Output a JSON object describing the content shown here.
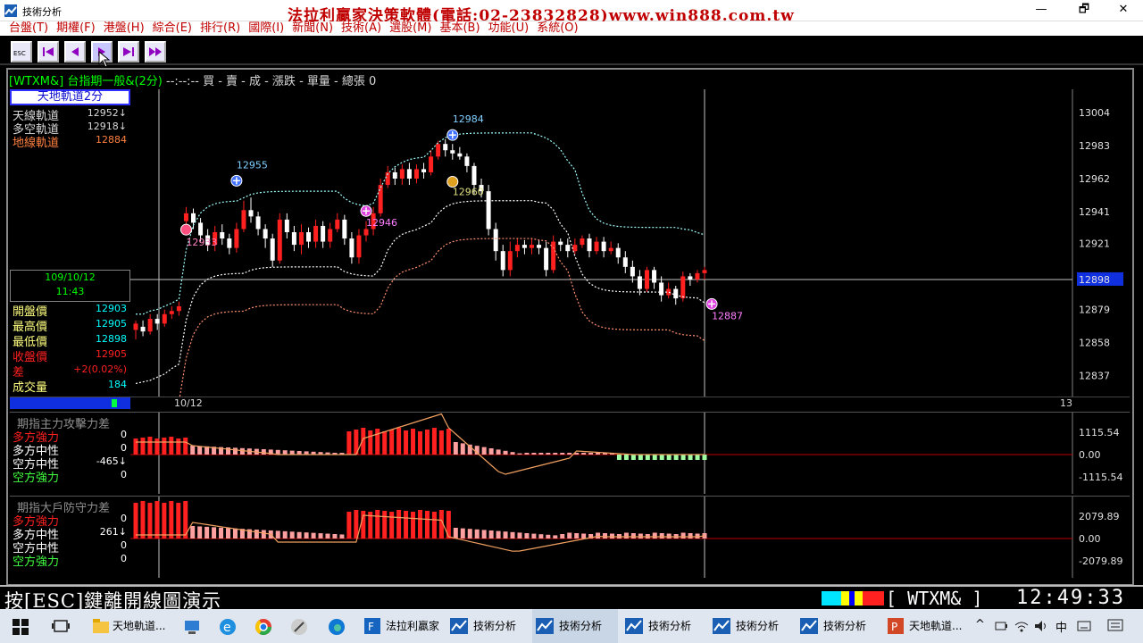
{
  "window": {
    "title": "技術分析",
    "banner": "法拉利贏家決策軟體(電話:02-23832828)www.win888.com.tw",
    "min_label": "—",
    "max_label": "🗗",
    "close_label": "✕"
  },
  "menu": [
    "台盤(T)",
    "期權(F)",
    "港盤(H)",
    "綜合(E)",
    "排行(R)",
    "國際(I)",
    "新聞(N)",
    "技術(A)",
    "選股(M)",
    "基本(B)",
    "功能(U)",
    "系統(O)"
  ],
  "toolbar": {
    "esc_label": "ESC"
  },
  "header": {
    "symbol": "[WTXM&] 台指期一般&(2分)",
    "rest": "--:--:-- 買 - 賣 - 成 - 漲跌 - 單量 - 總張 0"
  },
  "panel": {
    "title": "天地軌道2分",
    "indicators": [
      {
        "label": "天線軌道",
        "value": "12952",
        "arrow": "↓",
        "color": "#d8d8d8"
      },
      {
        "label": "多空軌道",
        "value": "12918",
        "arrow": "↓",
        "color": "#d8d8d8"
      },
      {
        "label": "地線軌道",
        "value": "12884",
        "arrow": "",
        "color": "#ff8040"
      }
    ],
    "date": "109/10/12",
    "time": "11:43",
    "quotes": [
      {
        "label": "開盤價",
        "value": "12903",
        "color": "#ffff80",
        "vcolor": "#00ffff"
      },
      {
        "label": "最高價",
        "value": "12905",
        "color": "#ffff80",
        "vcolor": "#00ffff"
      },
      {
        "label": "最低價",
        "value": "12898",
        "color": "#ffff80",
        "vcolor": "#00ffff"
      },
      {
        "label": "收盤價",
        "value": "12905",
        "color": "#ff2020",
        "vcolor": "#ff2020"
      },
      {
        "label": "差",
        "value": "+2(0.02%)",
        "color": "#ff2020",
        "vcolor": "#ff2020"
      },
      {
        "label": "成交量",
        "value": "184",
        "color": "#ffff80",
        "vcolor": "#00ffff"
      }
    ]
  },
  "chart_data": [
    {
      "type": "candlestick",
      "title": "",
      "y_ticks": [
        "13004",
        "12983",
        "12962",
        "12941",
        "12921",
        "12898",
        "12879",
        "12858",
        "12837"
      ],
      "ylim": [
        12826,
        13013
      ],
      "x_labels": [
        "10/12",
        "13"
      ],
      "current_price": "12898",
      "annotations": [
        {
          "label": "12955",
          "kind": "sell",
          "value": 12955
        },
        {
          "label": "12984",
          "kind": "sell",
          "value": 12984
        },
        {
          "label": "12933",
          "kind": "buy-circle",
          "value": 12933
        },
        {
          "label": "12946",
          "kind": "buy",
          "value": 12946
        },
        {
          "label": "12960",
          "kind": "neutral",
          "value": 12960
        },
        {
          "label": "12887",
          "kind": "buy",
          "value": 12887
        }
      ],
      "candles": [
        [
          12866,
          12870,
          12860,
          12872
        ],
        [
          12868,
          12865,
          12862,
          12872
        ],
        [
          12865,
          12873,
          12863,
          12876
        ],
        [
          12873,
          12870,
          12866,
          12876
        ],
        [
          12870,
          12876,
          12868,
          12879
        ],
        [
          12876,
          12878,
          12873,
          12881
        ],
        [
          12878,
          12881,
          12875,
          12884
        ],
        [
          12935,
          12940,
          12928,
          12944
        ],
        [
          12940,
          12934,
          12930,
          12943
        ],
        [
          12934,
          12926,
          12922,
          12937
        ],
        [
          12926,
          12920,
          12916,
          12930
        ],
        [
          12920,
          12928,
          12916,
          12932
        ],
        [
          12928,
          12924,
          12920,
          12933
        ],
        [
          12924,
          12918,
          12914,
          12927
        ],
        [
          12918,
          12930,
          12915,
          12934
        ],
        [
          12930,
          12942,
          12928,
          12948
        ],
        [
          12942,
          12938,
          12934,
          12950
        ],
        [
          12938,
          12930,
          12926,
          12941
        ],
        [
          12930,
          12924,
          12918,
          12933
        ],
        [
          12924,
          12910,
          12906,
          12927
        ],
        [
          12910,
          12936,
          12908,
          12940
        ],
        [
          12936,
          12928,
          12924,
          12940
        ],
        [
          12928,
          12920,
          12916,
          12932
        ],
        [
          12920,
          12928,
          12914,
          12933
        ],
        [
          12928,
          12922,
          12918,
          12931
        ],
        [
          12922,
          12932,
          12918,
          12936
        ],
        [
          12932,
          12922,
          12918,
          12935
        ],
        [
          12922,
          12930,
          12918,
          12934
        ],
        [
          12930,
          12936,
          12928,
          12940
        ],
        [
          12936,
          12924,
          12920,
          12939
        ],
        [
          12924,
          12912,
          12908,
          12928
        ],
        [
          12912,
          12926,
          12908,
          12930
        ],
        [
          12926,
          12930,
          12922,
          12935
        ],
        [
          12930,
          12940,
          12926,
          12944
        ],
        [
          12940,
          12958,
          12938,
          12962
        ],
        [
          12958,
          12966,
          12956,
          12970
        ],
        [
          12966,
          12962,
          12958,
          12969
        ],
        [
          12962,
          12968,
          12958,
          12971
        ],
        [
          12968,
          12962,
          12958,
          12972
        ],
        [
          12962,
          12968,
          12959,
          12971
        ],
        [
          12968,
          12966,
          12962,
          12972
        ],
        [
          12966,
          12976,
          12964,
          12980
        ],
        [
          12976,
          12984,
          12974,
          12986
        ],
        [
          12984,
          12980,
          12976,
          12987
        ],
        [
          12980,
          12978,
          12974,
          12984
        ],
        [
          12978,
          12976,
          12974,
          12982
        ],
        [
          12976,
          12970,
          12966,
          12978
        ],
        [
          12970,
          12958,
          12952,
          12972
        ],
        [
          12958,
          12954,
          12950,
          12962
        ],
        [
          12954,
          12930,
          12926,
          12958
        ],
        [
          12930,
          12916,
          12910,
          12934
        ],
        [
          12916,
          12904,
          12900,
          12920
        ],
        [
          12904,
          12916,
          12900,
          12922
        ],
        [
          12916,
          12920,
          12912,
          12924
        ],
        [
          12920,
          12918,
          12914,
          12923
        ],
        [
          12918,
          12920,
          12914,
          12924
        ],
        [
          12920,
          12918,
          12914,
          12923
        ],
        [
          12918,
          12904,
          12900,
          12922
        ],
        [
          12904,
          12922,
          12902,
          12926
        ],
        [
          12922,
          12920,
          12916,
          12924
        ],
        [
          12920,
          12916,
          12912,
          12924
        ],
        [
          12916,
          12920,
          12914,
          12924
        ],
        [
          12920,
          12924,
          12918,
          12926
        ],
        [
          12924,
          12916,
          12912,
          12927
        ],
        [
          12916,
          12922,
          12914,
          12925
        ],
        [
          12922,
          12916,
          12912,
          12925
        ],
        [
          12916,
          12918,
          12914,
          12922
        ],
        [
          12918,
          12912,
          12908,
          12921
        ],
        [
          12912,
          12906,
          12902,
          12916
        ],
        [
          12906,
          12900,
          12896,
          12910
        ],
        [
          12900,
          12892,
          12888,
          12904
        ],
        [
          12892,
          12904,
          12890,
          12906
        ],
        [
          12904,
          12896,
          12892,
          12906
        ],
        [
          12896,
          12888,
          12884,
          12900
        ],
        [
          12888,
          12892,
          12886,
          12896
        ],
        [
          12892,
          12886,
          12882,
          12894
        ],
        [
          12886,
          12900,
          12884,
          12903
        ],
        [
          12900,
          12898,
          12894,
          12902
        ],
        [
          12898,
          12902,
          12896,
          12904
        ],
        [
          12902,
          12904,
          12898,
          12906
        ]
      ]
    },
    {
      "type": "bar",
      "title": "期指主力攻擊力差",
      "y_ticks": [
        "1115.54",
        "0.00",
        "-1115.54"
      ],
      "legend": [
        {
          "label": "多方強力",
          "value": "0",
          "color": "#ff2020"
        },
        {
          "label": "多方中性",
          "value": "0",
          "color": "#ffffff"
        },
        {
          "label": "空方中性",
          "value": "-465",
          "arrow": "↓",
          "color": "#ffffff"
        },
        {
          "label": "空方強力",
          "value": "0",
          "color": "#40ff40"
        }
      ]
    },
    {
      "type": "bar",
      "title": "期指大戶防守力差",
      "y_ticks": [
        "2079.89",
        "0.00",
        "-2079.89"
      ],
      "legend": [
        {
          "label": "多方強力",
          "value": "0",
          "color": "#ff2020"
        },
        {
          "label": "多方中性",
          "value": "261",
          "arrow": "↓",
          "color": "#ffffff"
        },
        {
          "label": "空方中性",
          "value": "0",
          "color": "#ffffff"
        },
        {
          "label": "空方強力",
          "value": "0",
          "color": "#40ff40"
        }
      ]
    }
  ],
  "status": {
    "message": "按[ESC]鍵離開線圖演示",
    "symbol": "[ WTXM&  ]",
    "clock": "12:49:33"
  },
  "taskbar": {
    "items": [
      {
        "label": "天地軌道..."
      },
      {
        "label": "法拉利贏家"
      },
      {
        "label": "技術分析"
      },
      {
        "label": "技術分析"
      },
      {
        "label": "技術分析"
      },
      {
        "label": "技術分析"
      },
      {
        "label": "技術分析"
      },
      {
        "label": "天地軌道..."
      }
    ],
    "ime": "中"
  }
}
